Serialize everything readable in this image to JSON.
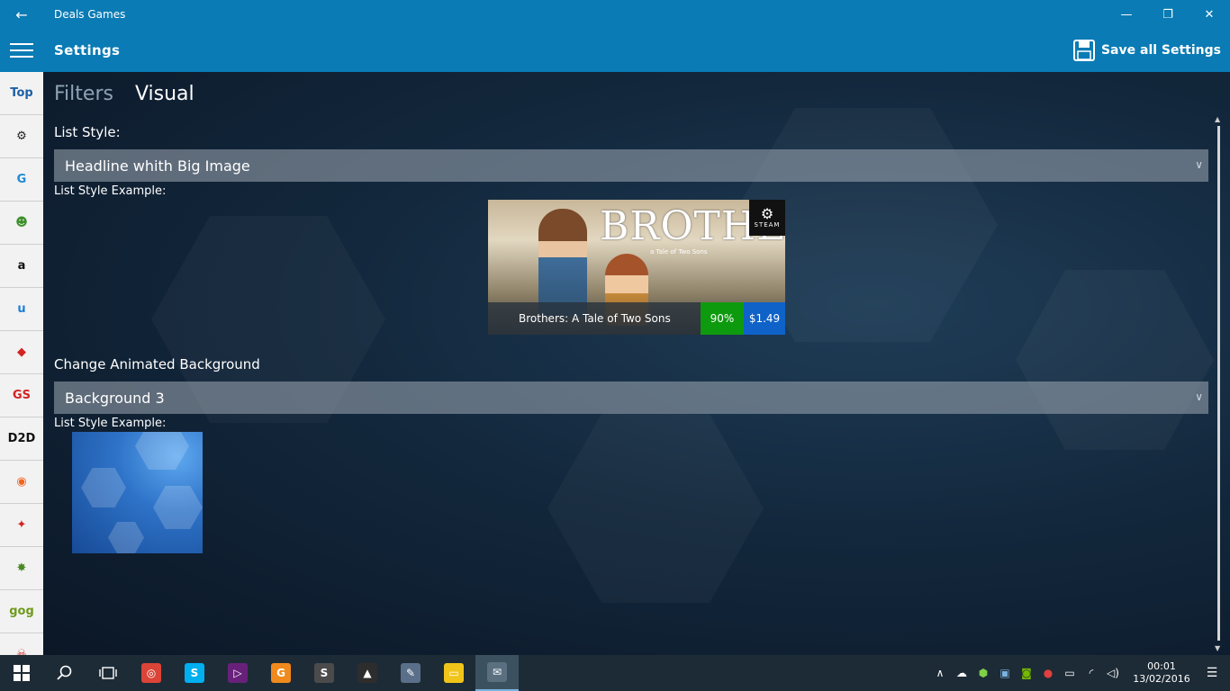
{
  "window": {
    "title": "Deals Games",
    "back_icon": "←",
    "minimize_icon": "—",
    "maximize_icon": "❐",
    "close_icon": "✕"
  },
  "header": {
    "title": "Settings",
    "save_label": "Save all Settings"
  },
  "sidebar": {
    "stores": [
      {
        "name": "top-deals",
        "label": "Top",
        "color": "#1c5fa6"
      },
      {
        "name": "steam",
        "label": "⚙",
        "color": "#222222"
      },
      {
        "name": "gamersgate",
        "label": "G",
        "color": "#1f8ad6"
      },
      {
        "name": "greenmangaming",
        "label": "☻",
        "color": "#3c8f2a"
      },
      {
        "name": "amazon",
        "label": "a",
        "color": "#111111"
      },
      {
        "name": "uplay",
        "label": "u",
        "color": "#1f7fd6"
      },
      {
        "name": "bundle-stars",
        "label": "◆",
        "color": "#d32424"
      },
      {
        "name": "gamestop",
        "label": "GS",
        "color": "#d32424"
      },
      {
        "name": "direct2drive",
        "label": "D2D",
        "color": "#111111"
      },
      {
        "name": "origin",
        "label": "◉",
        "color": "#f26422"
      },
      {
        "name": "humble",
        "label": "✦",
        "color": "#d32424"
      },
      {
        "name": "indiegala",
        "label": "✸",
        "color": "#4a8a22"
      },
      {
        "name": "gog",
        "label": "gog",
        "color": "#6f9a1e"
      },
      {
        "name": "more",
        "label": "☠",
        "color": "#d32424"
      }
    ]
  },
  "pivot": {
    "filters": "Filters",
    "visual": "Visual"
  },
  "list_style": {
    "label": "List Style:",
    "selected": "Headline whith Big Image",
    "example_label": "List Style Example:"
  },
  "example_card": {
    "logo": "BROTHERS",
    "subtitle": "a Tale of Two Sons",
    "steam_text": "STEAM",
    "name": "Brothers: A Tale of Two Sons",
    "discount": "90%",
    "price": "$1.49"
  },
  "background": {
    "label": "Change Animated Background",
    "selected": "Background 3",
    "example_label": "List Style Example:"
  },
  "taskbar": {
    "time": "00:01",
    "date": "13/02/2016",
    "apps": [
      {
        "name": "chrome",
        "label": "◎",
        "color": "#db4437"
      },
      {
        "name": "skype",
        "label": "S",
        "color": "#00aff0"
      },
      {
        "name": "visual-studio",
        "label": "▷",
        "color": "#68217a"
      },
      {
        "name": "pdf-app",
        "label": "G",
        "color": "#f08a1c"
      },
      {
        "name": "sublime",
        "label": "S",
        "color": "#4b4b4b"
      },
      {
        "name": "photos",
        "label": "▲",
        "color": "#2d2d2d"
      },
      {
        "name": "paint",
        "label": "✎",
        "color": "#5a6f8a"
      },
      {
        "name": "file-explorer",
        "label": "▭",
        "color": "#f0c419"
      },
      {
        "name": "deals-games",
        "label": "✉",
        "color": "#5a6f80"
      }
    ]
  }
}
